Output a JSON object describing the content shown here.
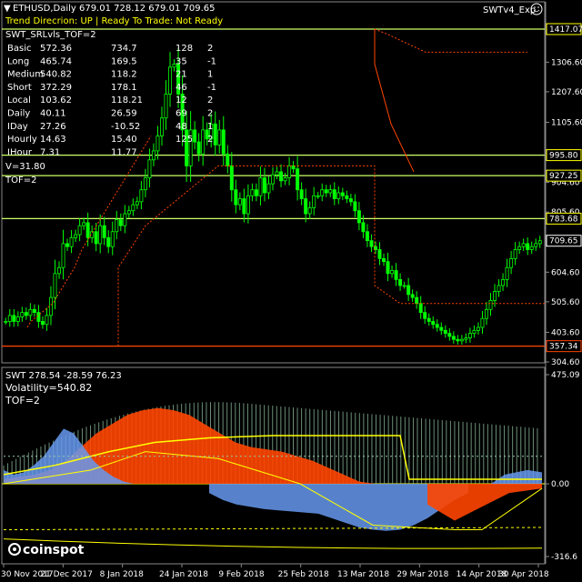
{
  "header": {
    "symbol_line": "ETHUSD,Daily  679.01 728.12 679.01 709.65",
    "indicator_name": "SWTv4_Exp",
    "trend_line": "Trend Direcrion:  UP   |  Ready To Trade:  Not Ready"
  },
  "info_panel": {
    "title": "SWT_SRLvls_TOF=2",
    "rows": [
      {
        "label": "Basic",
        "v1": "572.36",
        "v2": "734.7",
        "v3": "128",
        "v4": "2"
      },
      {
        "label": "Long",
        "v1": "465.74",
        "v2": "169.5",
        "v3": "35",
        "v4": "-1"
      },
      {
        "label": "Medium",
        "v1": "540.82",
        "v2": "118.2",
        "v3": "21",
        "v4": "1"
      },
      {
        "label": "Short",
        "v1": "372.29",
        "v2": "178.1",
        "v3": "46",
        "v4": "-1"
      },
      {
        "label": "Local",
        "v1": "103.62",
        "v2": "118.21",
        "v3": "12",
        "v4": "2"
      },
      {
        "label": "Daily",
        "v1": "40.11",
        "v2": "26.59",
        "v3": "69",
        "v4": "2"
      },
      {
        "label": "IDay",
        "v1": "27.26",
        "v2": "-10.52",
        "v3": "48",
        "v4": "1"
      },
      {
        "label": "Hourly",
        "v1": "14.63",
        "v2": "15.40",
        "v3": "125",
        "v4": "2"
      },
      {
        "label": "IHour",
        "v1": "7.31",
        "v2": "11.77",
        "v3": "",
        "v4": ""
      }
    ],
    "volume": "V=31.80",
    "tof": "TOF=2"
  },
  "sub_panel": {
    "title": "SWT 278.54 -28.59 76.23",
    "volatility": "Volatility=540.82",
    "tof": "TOF=2"
  },
  "watermark": "coinspot",
  "colors": {
    "bull": "#00ff00",
    "bear": "#00ff00",
    "accent_orange": "#ff4500",
    "level_yellow": "#ccff66",
    "sub_blue": "#6699ee",
    "sub_orange": "#ff4500",
    "sub_green_hatch": "#99ccaa",
    "sub_yellow": "#ffff00",
    "grid": "#ffffff"
  },
  "chart_data": [
    {
      "type": "candlestick",
      "title": "ETHUSD,Daily",
      "ylim": [
        304.6,
        1417.07
      ],
      "y_ticks": [
        "1306.60",
        "1207.60",
        "1105.60",
        "904.60",
        "805.60",
        "604.60",
        "505.60",
        "403.60",
        "304.60"
      ],
      "x_ticks": [
        "30 Nov 2017",
        "21 Dec 2017",
        "8 Jan 2018",
        "24 Jan 2018",
        "9 Feb 2018",
        "25 Feb 2018",
        "13 Mar 2018",
        "29 Mar 2018",
        "14 Apr 2018",
        "30 Apr 2018"
      ],
      "price_labels": [
        {
          "value": 1417.07,
          "text": "1417.07",
          "color": "#ffff00"
        },
        {
          "value": 995.8,
          "text": "995.80",
          "color": "#ffff00"
        },
        {
          "value": 927.25,
          "text": "927.25",
          "color": "#ffff00"
        },
        {
          "value": 783.68,
          "text": "783.68",
          "color": "#ffff00"
        },
        {
          "value": 709.65,
          "text": "709.65",
          "color": "#ffffff"
        },
        {
          "value": 357.34,
          "text": "357.34",
          "color": "#ff4500"
        }
      ],
      "levels": [
        {
          "value": 1417.07,
          "color": "#ccff66"
        },
        {
          "value": 995.8,
          "color": "#ccff66"
        },
        {
          "value": 927.25,
          "color": "#ccff66"
        },
        {
          "value": 783.68,
          "color": "#ccff66"
        },
        {
          "value": 357.34,
          "color": "#ff4500"
        }
      ],
      "close": [
        440,
        460,
        440,
        455,
        470,
        460,
        480,
        470,
        440,
        430,
        460,
        520,
        600,
        620,
        700,
        690,
        720,
        730,
        760,
        770,
        720,
        740,
        700,
        760,
        720,
        690,
        740,
        780,
        760,
        800,
        810,
        830,
        840,
        880,
        920,
        980,
        1010,
        1060,
        1120,
        1200,
        1290,
        1300,
        1200,
        1080,
        960,
        1080,
        1040,
        1000,
        1080,
        1050,
        1100,
        1030,
        1080,
        1000,
        960,
        880,
        830,
        850,
        800,
        860,
        880,
        860,
        920,
        870,
        900,
        930,
        940,
        910,
        920,
        960,
        950,
        880,
        850,
        800,
        820,
        860,
        860,
        880,
        870,
        880,
        850,
        870,
        860,
        850,
        840,
        810,
        770,
        740,
        710,
        690,
        680,
        650,
        640,
        600,
        610,
        580,
        560,
        560,
        530,
        520,
        500,
        470,
        450,
        440,
        430,
        420,
        410,
        400,
        390,
        380,
        375,
        380,
        385,
        400,
        410,
        420,
        450,
        480,
        510,
        540,
        560,
        580,
        620,
        650,
        680,
        690,
        700,
        680,
        690,
        700,
        709.65
      ],
      "support_dotted": [
        420,
        440,
        450,
        460,
        470,
        480,
        490,
        500,
        520,
        540,
        560,
        580,
        600,
        620,
        650,
        680,
        700,
        720,
        740,
        760,
        780,
        800,
        820,
        840,
        860,
        880,
        900,
        920,
        940,
        960,
        980,
        1000,
        1020,
        1040,
        1060
      ],
      "resistance_dotted": [
        1417,
        1400,
        1380,
        1360,
        1340,
        1340,
        1340,
        1340,
        1340,
        1340,
        1340,
        1340,
        1340
      ]
    },
    {
      "type": "area",
      "title": "SWT",
      "ylim": [
        -316.6,
        475.09
      ],
      "y_ticks": [
        "475.09",
        "0.00",
        "-316.6"
      ],
      "zero": 0.0
    }
  ]
}
